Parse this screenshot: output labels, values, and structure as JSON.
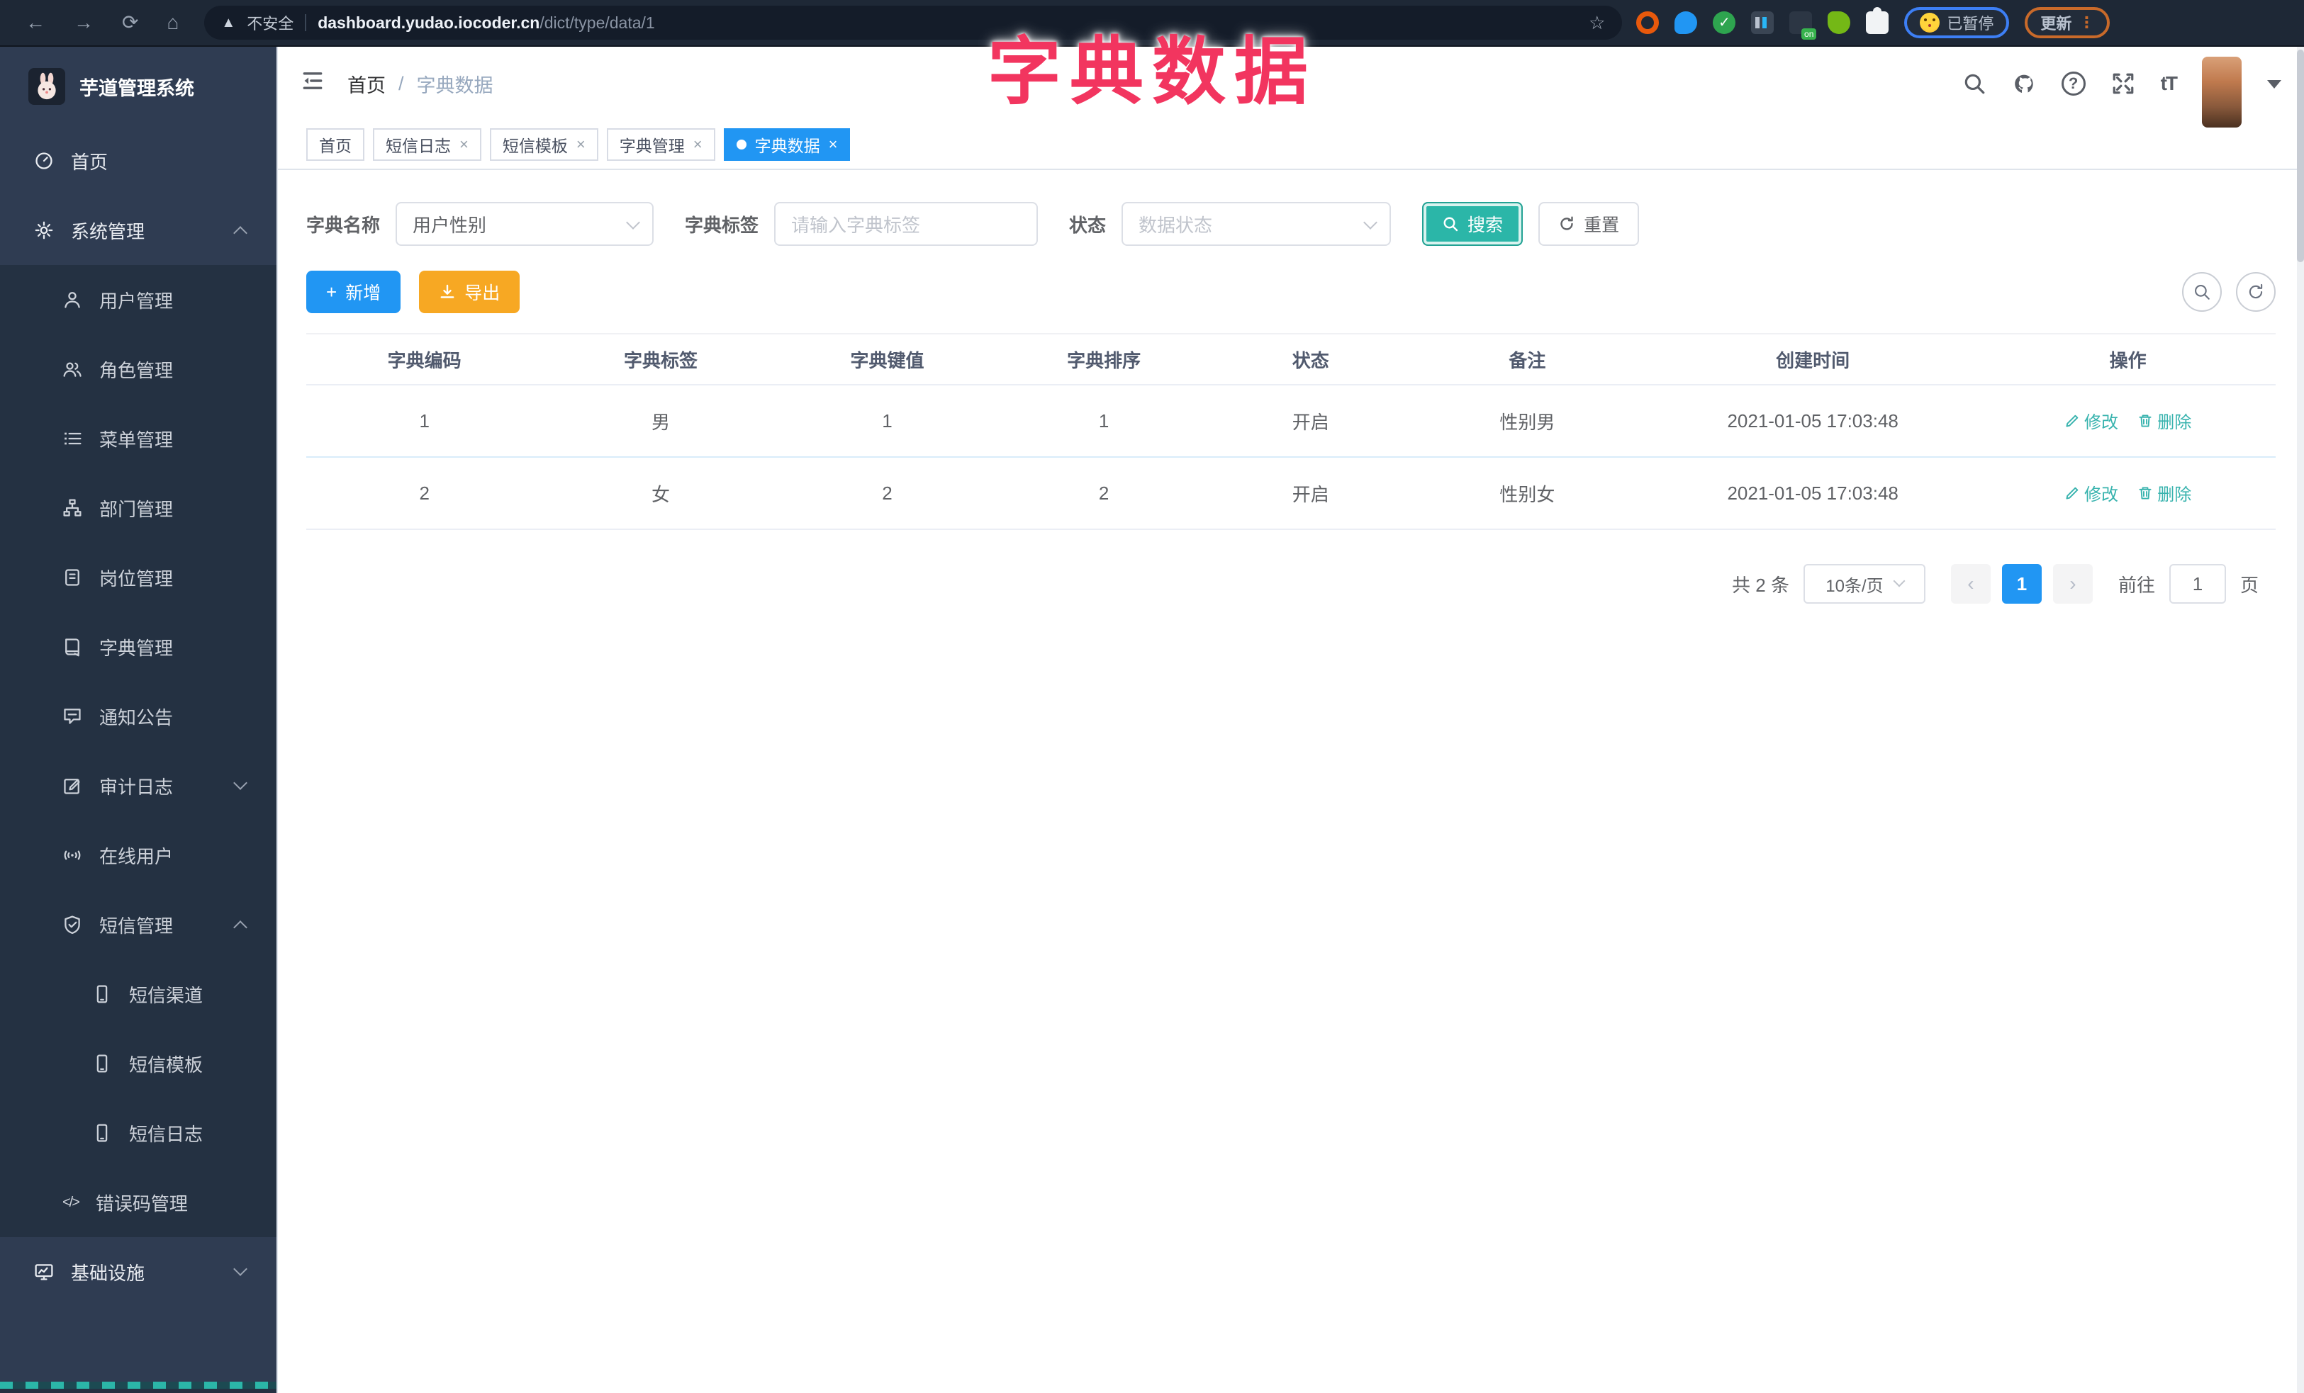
{
  "browser": {
    "security_label": "不安全",
    "url_host": "dashboard.yudao.iocoder.cn",
    "url_path": "/dict/type/data/1",
    "paused_chip": "已暂停",
    "update_button": "更新"
  },
  "overlay_title": "字典数据",
  "sidebar": {
    "logo_title": "芋道管理系统",
    "items": [
      {
        "label": "首页"
      },
      {
        "label": "系统管理"
      },
      {
        "label": "用户管理"
      },
      {
        "label": "角色管理"
      },
      {
        "label": "菜单管理"
      },
      {
        "label": "部门管理"
      },
      {
        "label": "岗位管理"
      },
      {
        "label": "字典管理"
      },
      {
        "label": "通知公告"
      },
      {
        "label": "审计日志"
      },
      {
        "label": "在线用户"
      },
      {
        "label": "短信管理"
      },
      {
        "label": "短信渠道"
      },
      {
        "label": "短信模板"
      },
      {
        "label": "短信日志"
      },
      {
        "label": "错误码管理"
      },
      {
        "label": "基础设施"
      }
    ]
  },
  "navbar": {
    "breadcrumb_home": "首页",
    "breadcrumb_sep": "/",
    "breadcrumb_current": "字典数据",
    "font_icon_label": "tT"
  },
  "tabs": [
    {
      "label": "首页"
    },
    {
      "label": "短信日志"
    },
    {
      "label": "短信模板"
    },
    {
      "label": "字典管理"
    },
    {
      "label": "字典数据"
    }
  ],
  "search": {
    "name_label": "字典名称",
    "name_value": "用户性别",
    "tag_label": "字典标签",
    "tag_placeholder": "请输入字典标签",
    "status_label": "状态",
    "status_placeholder": "数据状态",
    "search_button": "搜索",
    "reset_button": "重置"
  },
  "toolbar": {
    "add_button": "新增",
    "export_button": "导出"
  },
  "table": {
    "columns": [
      "字典编码",
      "字典标签",
      "字典键值",
      "字典排序",
      "状态",
      "备注",
      "创建时间",
      "操作"
    ],
    "rows": [
      {
        "code": "1",
        "label": "男",
        "value": "1",
        "sort": "1",
        "status": "开启",
        "remark": "性别男",
        "created": "2021-01-05 17:03:48"
      },
      {
        "code": "2",
        "label": "女",
        "value": "2",
        "sort": "2",
        "status": "开启",
        "remark": "性别女",
        "created": "2021-01-05 17:03:48"
      }
    ],
    "edit_action": "修改",
    "delete_action": "删除"
  },
  "pagination": {
    "total_text": "共 2 条",
    "page_size": "10条/页",
    "current_page": "1",
    "goto_label": "前往",
    "goto_value": "1",
    "goto_unit": "页"
  },
  "colors": {
    "accent_blue": "#2196f3",
    "teal": "#2bb6a8",
    "amber": "#f7a823",
    "overlay_red": "#f2355f",
    "sidebar_bg": "#243142",
    "browser_bar_bg": "#1e2836"
  }
}
